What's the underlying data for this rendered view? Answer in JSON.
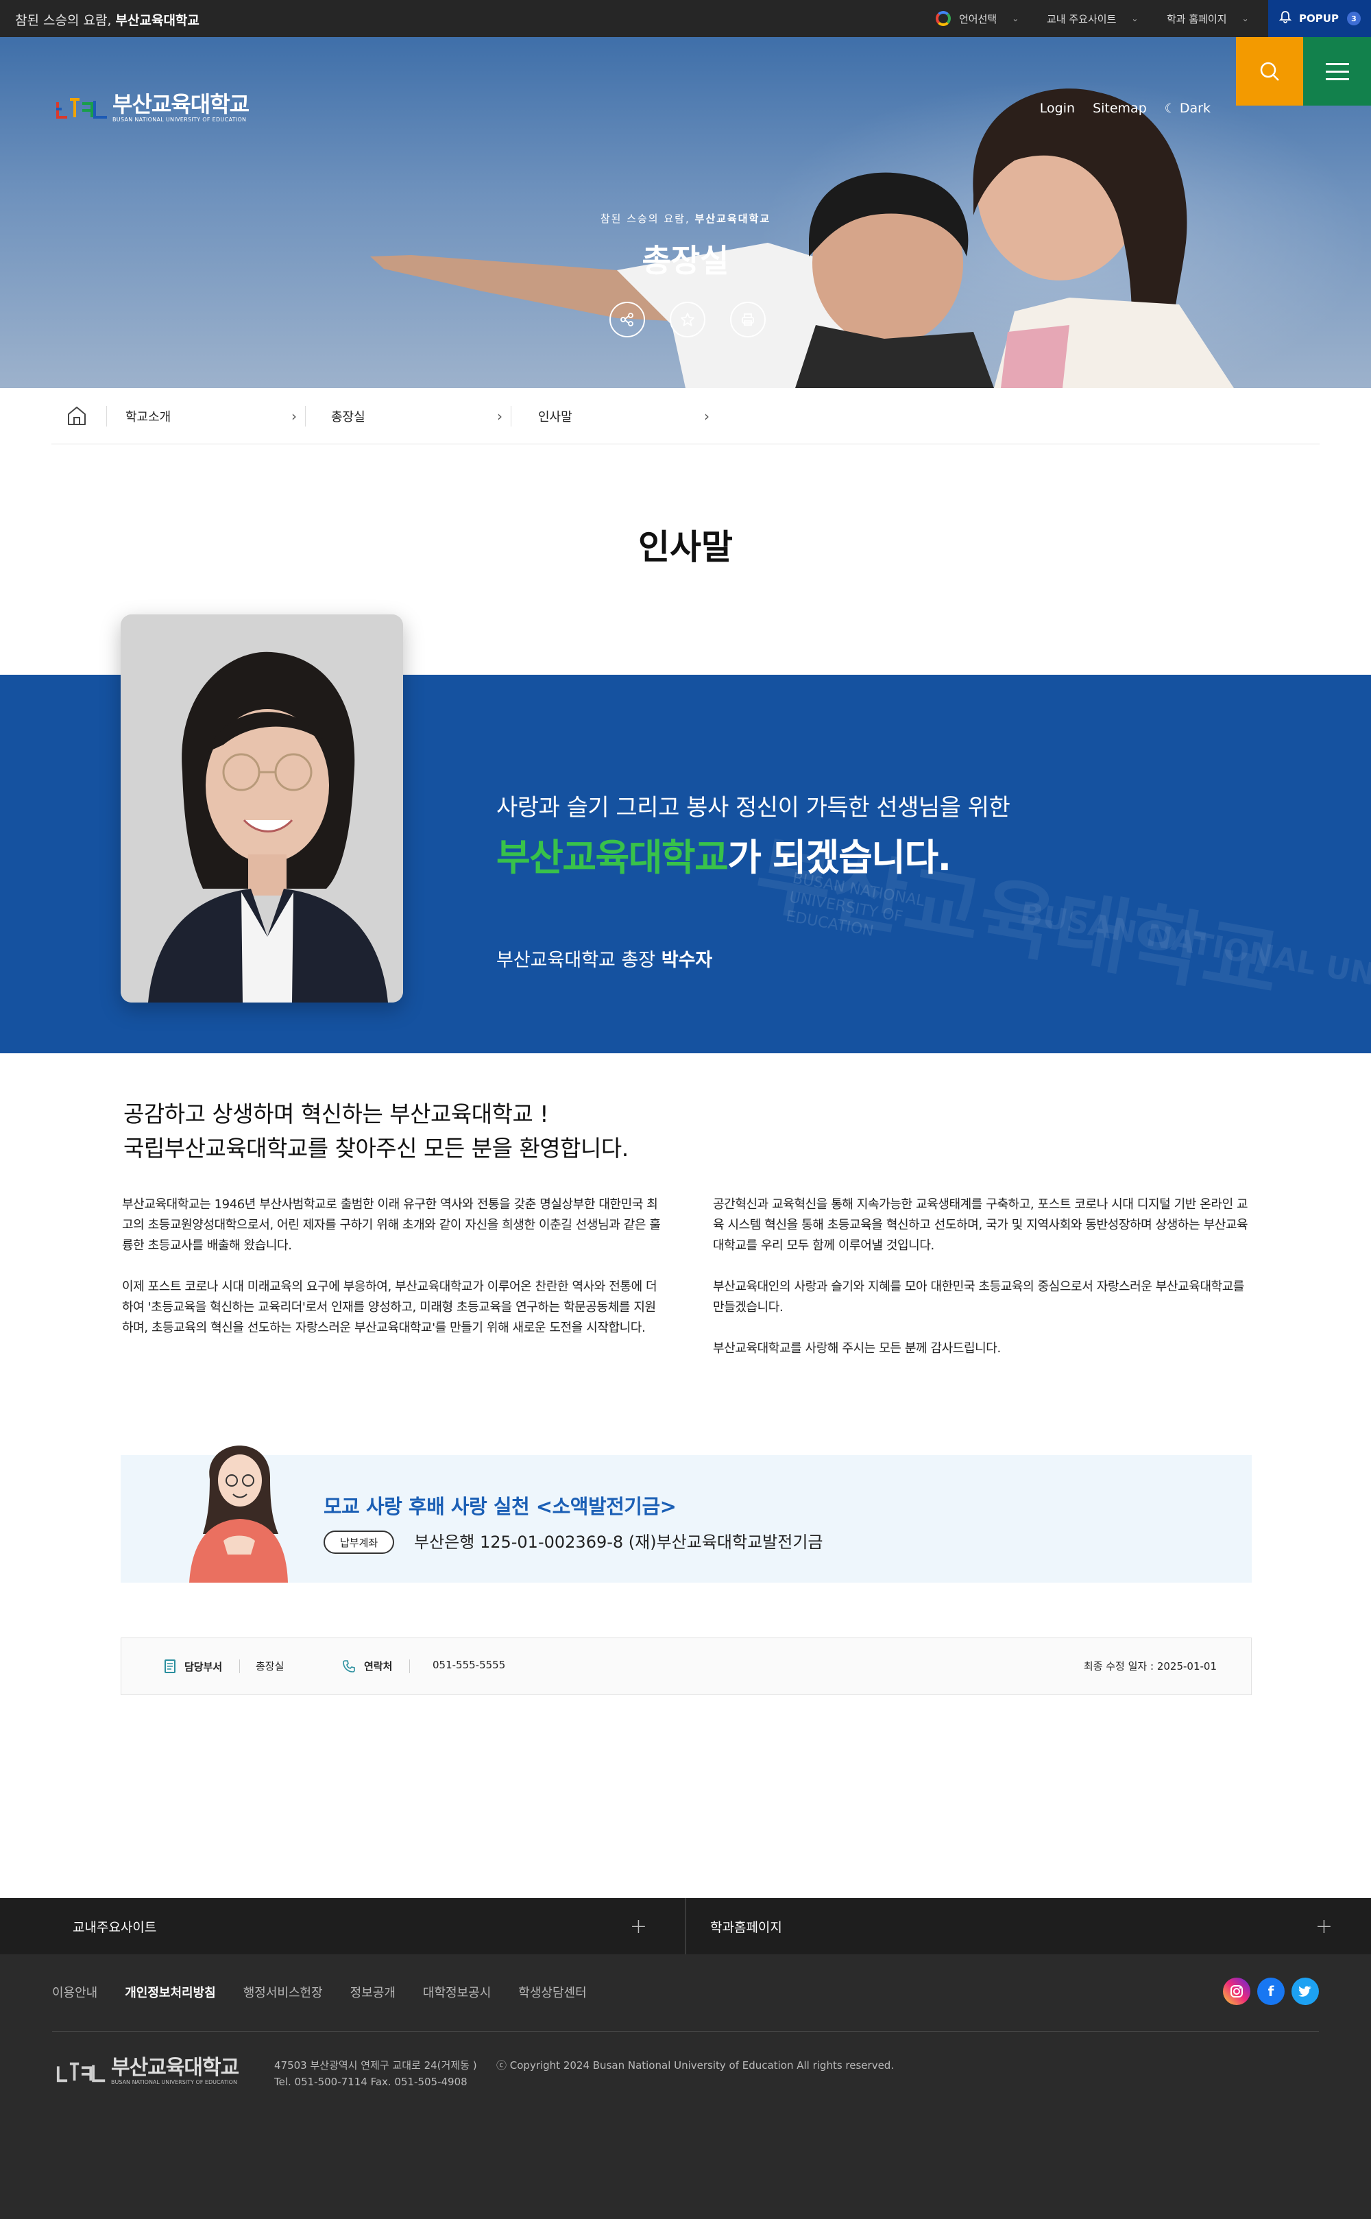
{
  "topbar": {
    "slogan_pre": "참된 스승의 요람,",
    "slogan_strong": "부산교육대학교",
    "language": "언어선택",
    "main_sites": "교내 주요사이트",
    "dept_homepage": "학과 홈페이지",
    "popup_label": "POPUP",
    "popup_count": "3"
  },
  "header": {
    "logo_ko": "부산교육대학교",
    "logo_en": "BUSAN NATIONAL UNIVERSITY OF EDUCATION",
    "login": "Login",
    "sitemap": "Sitemap",
    "dark": "Dark"
  },
  "hero": {
    "subtitle_pre": "참된 스승의 요람,",
    "subtitle_strong": "부산교육대학교",
    "title": "총장실"
  },
  "breadcrumb": {
    "items": [
      {
        "label": "학교소개"
      },
      {
        "label": "총장실"
      },
      {
        "label": "인사말"
      }
    ]
  },
  "page": {
    "title": "인사말"
  },
  "band": {
    "line1": "사랑과 슬기 그리고 봉사 정신이 가득한 선생님을 위한",
    "line2_green": "부산교육대학교",
    "line2_rest": "가 되겠습니다.",
    "signature_pre": "부산교육대학교 총장",
    "signature_name": "박수자",
    "sign_text_1": "BUSAN NATIONAL",
    "sign_text_2": "UNIVERSITY OF",
    "sign_text_3": "EDUCATION"
  },
  "greeting": {
    "headline_1": "공감하고 상생하며 혁신하는 부산교육대학교 !",
    "headline_2": "국립부산교육대학교를 찾아주신 모든 분을 환영합니다.",
    "left_p1": "부산교육대학교는 1946년 부산사범학교로 출범한 이래 유구한 역사와 전통을 갖춘 명실상부한 대한민국 최고의 초등교원양성대학으로서, 어린 제자를 구하기 위해 초개와 같이 자신을 희생한 이춘길 선생님과 같은 훌륭한 초등교사를 배출해 왔습니다.",
    "left_p2": "이제 포스트 코로나 시대 미래교육의 요구에 부응하여, 부산교육대학교가 이루어온 찬란한 역사와 전통에 더하여 '초등교육을 혁신하는 교육리더'로서 인재를 양성하고, 미래형 초등교육을 연구하는 학문공동체를 지원하며, 초등교육의 혁신을 선도하는 자랑스러운 부산교육대학교'를 만들기 위해 새로운 도전을 시작합니다.",
    "right_p1": "공간혁신과 교육혁신을 통해 지속가능한 교육생태계를 구축하고, 포스트 코로나 시대 디지털 기반 온라인 교육 시스템 혁신을 통해 초등교육을 혁신하고 선도하며, 국가 및 지역사회와 동반성장하며 상생하는 부산교육대학교를 우리 모두 함께 이루어낼 것입니다.",
    "right_p2": "부산교육대인의 사랑과 슬기와 지혜를 모아 대한민국 초등교육의 중심으로서 자랑스러운 부산교육대학교를 만들겠습니다.",
    "right_p3": "부산교육대학교를 사랑해 주시는 모든 분께 감사드립니다."
  },
  "fund": {
    "title": "모교 사랑 후배 사랑 실천 <소액발전기금>",
    "tag": "납부계좌",
    "account": "부산은행 125-01-002369-8 (재)부산교육대학교발전기금"
  },
  "contact": {
    "dept_label": "담당부서",
    "dept_value": "총장실",
    "phone_label": "연락처",
    "phone_value": "051-555-5555",
    "updated": "최종 수정 일자 : 2025-01-01"
  },
  "footer": {
    "main_sites": "교내주요사이트",
    "dept_homepage": "학과홈페이지",
    "links": [
      {
        "label": "이용안내"
      },
      {
        "label": "개인정보처리방침"
      },
      {
        "label": "행정서비스헌장"
      },
      {
        "label": "정보공개"
      },
      {
        "label": "대학정보공시"
      },
      {
        "label": "학생상담센터"
      }
    ],
    "logo_ko": "부산교육대학교",
    "logo_en": "BUSAN NATIONAL UNIVERSITY OF EDUCATION",
    "address": "47503 부산광역시 연제구 교대로 24(거제동 )",
    "tel": "Tel. 051-500-7114 Fax. 051-505-4908",
    "copyright": "ⓒ Copyright 2024 Busan National University of Education All rights reserved."
  },
  "colors": {
    "topbar": "#262626",
    "popup": "#0a3b8c",
    "search": "#f39a00",
    "menu": "#12814c",
    "band": "#1552a0",
    "accent_green": "#38c24a",
    "fund_title": "#1b5fb5",
    "footer": "#2b2b2b"
  },
  "icons": [
    "google-icon",
    "chevron-down-icon",
    "bell-icon",
    "moon-icon",
    "search-icon",
    "hamburger-icon",
    "share-icon",
    "star-icon",
    "print-icon",
    "home-icon",
    "chevron-right-icon",
    "document-icon",
    "phone-icon",
    "plus-icon",
    "instagram-icon",
    "facebook-icon",
    "twitter-icon"
  ]
}
